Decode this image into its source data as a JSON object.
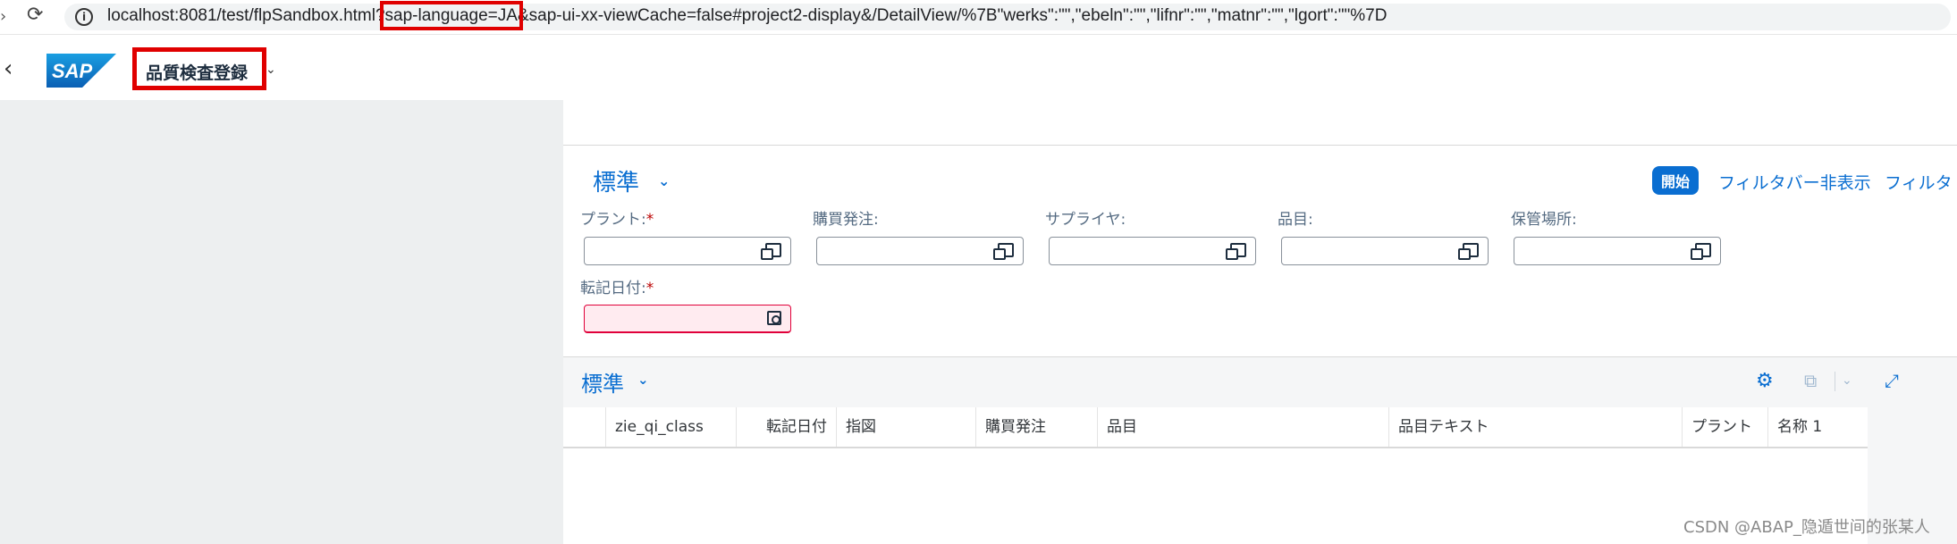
{
  "browser": {
    "url_prefix": "localhost:8081/test/flpSandbox.html?",
    "url_highlight": "sap-language=JA",
    "url_suffix": "&sap-ui-xx-viewCache=false#project2-display&/DetailView/%7B\"werks\":\"\",\"ebeln\":\"\",\"lifnr\":\"\",\"matnr\":\"\",\"lgort\":\"\"%7D"
  },
  "shell": {
    "logo_text": "SAP",
    "app_title": "品質検査登録"
  },
  "filter_bar": {
    "variant": "標準",
    "go_label": "開始",
    "hide_filter_label": "フィルタバー非表示",
    "filters_label": "フィルタ",
    "fields": [
      {
        "label": "プラント:",
        "required": "*",
        "value": ""
      },
      {
        "label": "購買発注:",
        "value": ""
      },
      {
        "label": "サプライヤ:",
        "value": ""
      },
      {
        "label": "品目:",
        "value": ""
      },
      {
        "label": "保管場所:",
        "value": ""
      },
      {
        "label": "転記日付:",
        "required": "*",
        "value": ""
      }
    ]
  },
  "table": {
    "variant": "標準",
    "columns": [
      "zie_qi_class",
      "転記日付",
      "指図",
      "購買発注",
      "品目",
      "品目テキスト",
      "プラント",
      "名称 1"
    ]
  },
  "watermark": "CSDN @ABAP_隐遁世间的张某人",
  "colors": {
    "accent": "#0a6ed1",
    "highlight_box": "#e00000",
    "error_field_bg": "#ffebf0"
  }
}
